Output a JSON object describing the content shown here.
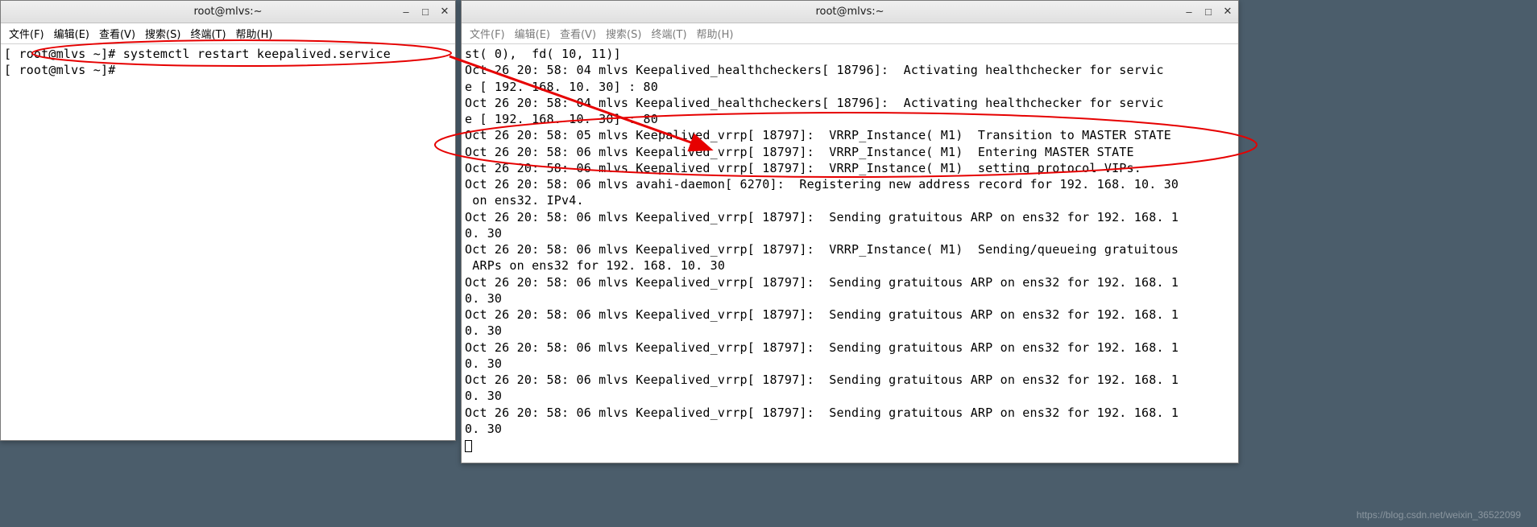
{
  "left_window": {
    "title": "root@mlvs:~",
    "menus": [
      "文件(F)",
      "编辑(E)",
      "查看(V)",
      "搜索(S)",
      "终端(T)",
      "帮助(H)"
    ],
    "lines": [
      "[ root@mlvs ~]# systemctl restart keepalived.service",
      "[ root@mlvs ~]#"
    ]
  },
  "right_window": {
    "title": "root@mlvs:~",
    "menus": [
      "文件(F)",
      "编辑(E)",
      "查看(V)",
      "搜索(S)",
      "终端(T)",
      "帮助(H)"
    ],
    "lines": [
      "st( 0),  fd( 10, 11)]",
      "Oct 26 20: 58: 04 mlvs Keepalived_healthcheckers[ 18796]:  Activating healthchecker for servic",
      "e [ 192. 168. 10. 30] : 80",
      "Oct 26 20: 58: 04 mlvs Keepalived_healthcheckers[ 18796]:  Activating healthchecker for servic",
      "e [ 192. 168. 10. 30] : 80",
      "Oct 26 20: 58: 05 mlvs Keepalived_vrrp[ 18797]:  VRRP_Instance( M1)  Transition to MASTER STATE",
      "Oct 26 20: 58: 06 mlvs Keepalived_vrrp[ 18797]:  VRRP_Instance( M1)  Entering MASTER STATE",
      "Oct 26 20: 58: 06 mlvs Keepalived_vrrp[ 18797]:  VRRP_Instance( M1)  setting protocol VIPs.",
      "Oct 26 20: 58: 06 mlvs avahi-daemon[ 6270]:  Registering new address record for 192. 168. 10. 30",
      " on ens32. IPv4.",
      "Oct 26 20: 58: 06 mlvs Keepalived_vrrp[ 18797]:  Sending gratuitous ARP on ens32 for 192. 168. 1",
      "0. 30",
      "Oct 26 20: 58: 06 mlvs Keepalived_vrrp[ 18797]:  VRRP_Instance( M1)  Sending/queueing gratuitous",
      " ARPs on ens32 for 192. 168. 10. 30",
      "Oct 26 20: 58: 06 mlvs Keepalived_vrrp[ 18797]:  Sending gratuitous ARP on ens32 for 192. 168. 1",
      "0. 30",
      "Oct 26 20: 58: 06 mlvs Keepalived_vrrp[ 18797]:  Sending gratuitous ARP on ens32 for 192. 168. 1",
      "0. 30",
      "Oct 26 20: 58: 06 mlvs Keepalived_vrrp[ 18797]:  Sending gratuitous ARP on ens32 for 192. 168. 1",
      "0. 30",
      "Oct 26 20: 58: 06 mlvs Keepalived_vrrp[ 18797]:  Sending gratuitous ARP on ens32 for 192. 168. 1",
      "0. 30",
      "Oct 26 20: 58: 06 mlvs Keepalived_vrrp[ 18797]:  Sending gratuitous ARP on ens32 for 192. 168. 1",
      "0. 30"
    ]
  },
  "watermark": "https://blog.csdn.net/weixin_36522099"
}
